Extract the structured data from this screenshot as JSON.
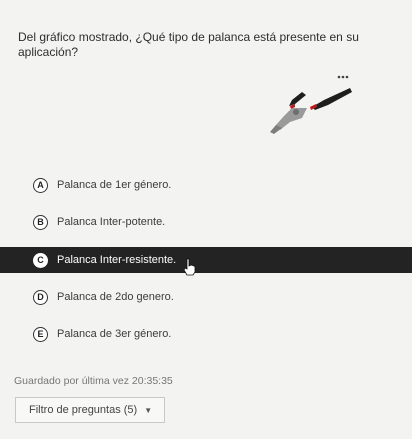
{
  "question": {
    "text": "Del gráfico mostrado, ¿Qué tipo de palanca está presente en su aplicación?"
  },
  "image": {
    "icon": "pliers-icon",
    "handle_color": "#1e1e1e",
    "accent_color": "#c0171a"
  },
  "options": [
    {
      "letter": "A",
      "label": "Palanca de 1er género.",
      "selected": false
    },
    {
      "letter": "B",
      "label": "Palanca Inter-potente.",
      "selected": false
    },
    {
      "letter": "C",
      "label": "Palanca Inter-resistente.",
      "selected": true
    },
    {
      "letter": "D",
      "label": "Palanca de 2do genero.",
      "selected": false
    },
    {
      "letter": "E",
      "label": "Palanca de 3er género.",
      "selected": false
    }
  ],
  "status": {
    "saved_text": "Guardado por última vez 20:35:35"
  },
  "filter": {
    "label": "Filtro de preguntas (5)",
    "caret_icon": "caret-down-icon"
  },
  "colors": {
    "selected_bg": "#232323",
    "page_bg": "#f3f3f1"
  }
}
